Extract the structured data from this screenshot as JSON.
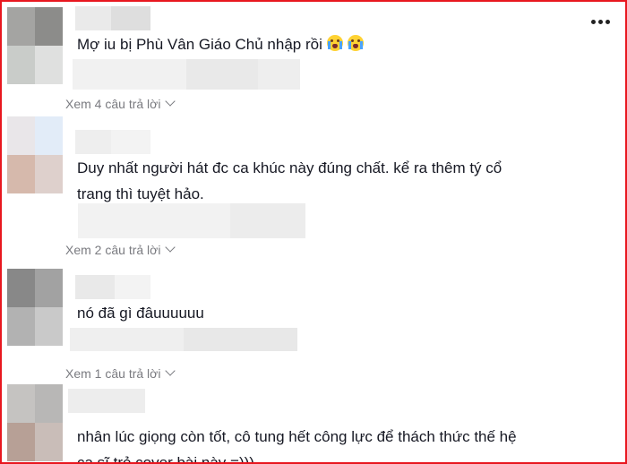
{
  "comments": [
    {
      "text": "Mợ iu bị Phù Vân Giáo Chủ nhập rồi",
      "emoji": [
        "loudly-crying-face",
        "loudly-crying-face"
      ],
      "replies_label": "Xem 4 câu trả lời"
    },
    {
      "text_line1": "Duy nhất người hát đc ca khúc này đúng chất. kể ra thêm tý cổ",
      "text_line2": "trang thì tuyệt hảo.",
      "replies_label": "Xem 2 câu trả lời"
    },
    {
      "text": "nó đã gì đâuuuuuu",
      "replies_label": "Xem 1 câu trả lời"
    },
    {
      "text_line1": "nhân lúc giọng còn tốt, cô tung hết công lực để thách thức thế hệ",
      "text_line2": "ca sĩ trẻ cover bài này =)))"
    }
  ],
  "colors": {
    "border": "#e8171f",
    "text": "#161823",
    "secondary": "#7a7b80"
  },
  "icons": [
    "more-horizontal-icon",
    "chevron-down-icon",
    "loudly-crying-face-emoji"
  ]
}
